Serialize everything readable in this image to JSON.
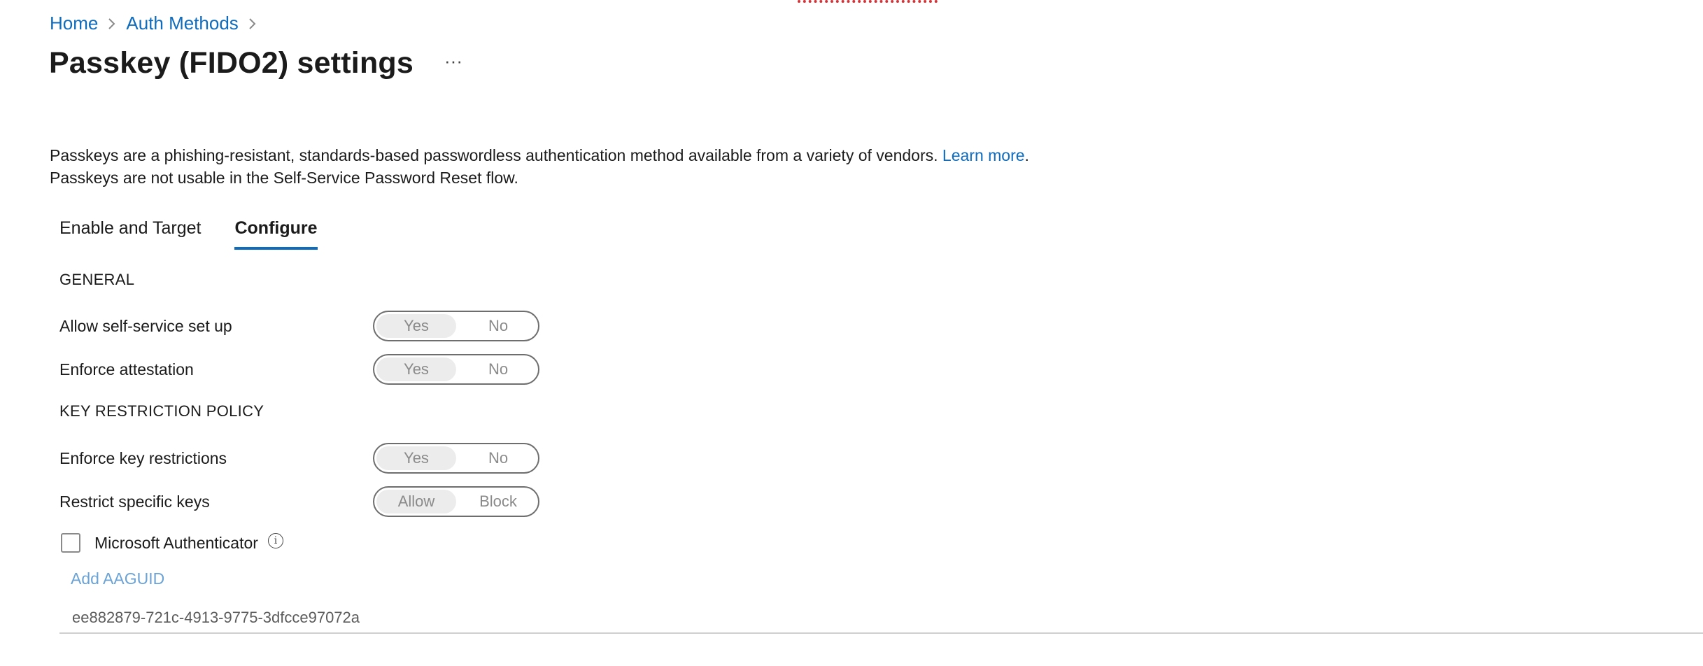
{
  "breadcrumb": {
    "items": [
      "Home",
      "Auth Methods"
    ],
    "separator": ">"
  },
  "page": {
    "title": "Passkey (FIDO2) settings",
    "more_label": "···"
  },
  "description": {
    "line1": "Passkeys are a phishing-resistant, standards-based passwordless authentication method available from a variety of vendors.",
    "learn_more": "Learn more",
    "line1_end": ".",
    "line2": "Passkeys are not usable in the Self-Service Password Reset flow."
  },
  "tabs": [
    {
      "label": "Enable and Target",
      "active": false
    },
    {
      "label": "Configure",
      "active": true
    }
  ],
  "general": {
    "heading": "GENERAL",
    "settings": [
      {
        "label": "Allow self-service set up",
        "options": [
          "Yes",
          "No"
        ],
        "selected": "Yes"
      },
      {
        "label": "Enforce attestation",
        "options": [
          "Yes",
          "No"
        ],
        "selected": "Yes"
      }
    ]
  },
  "key_restriction": {
    "heading": "KEY RESTRICTION POLICY",
    "settings": [
      {
        "label": "Enforce key restrictions",
        "options": [
          "Yes",
          "No"
        ],
        "selected": "Yes"
      },
      {
        "label": "Restrict specific keys",
        "options": [
          "Allow",
          "Block"
        ],
        "selected": "Allow"
      }
    ],
    "checkbox_label": "Microsoft Authenticator",
    "checkbox_checked": false,
    "add_link": "Add AAGUID",
    "aaguid_value": "ee882879-721c-4913-9775-3dfcce97072a"
  },
  "colors": {
    "accent": "#0f6cbd",
    "link_muted": "#6ba3d6",
    "error_dots": "#d13438"
  },
  "icons": {
    "more": "ellipsis-icon",
    "info": "info-icon",
    "chevron": "chevron-right-icon"
  }
}
